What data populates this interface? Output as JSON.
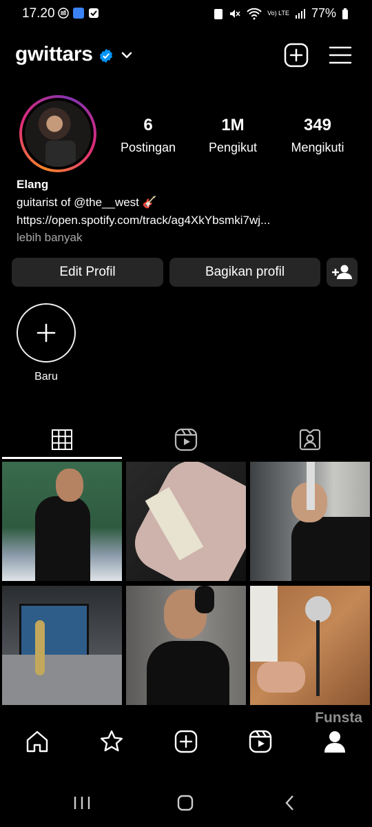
{
  "status_bar": {
    "time": "17.20",
    "battery": "77%",
    "network": "Vo) LTE"
  },
  "header": {
    "username": "gwittars",
    "icons": [
      "verified-badge-icon",
      "chevron-down-icon",
      "create-post-icon",
      "menu-icon"
    ],
    "accent_color": "#0095f6"
  },
  "profile": {
    "stats": [
      {
        "value": "6",
        "label": "Postingan"
      },
      {
        "value": "1M",
        "label": "Pengikut"
      },
      {
        "value": "349",
        "label": "Mengikuti"
      }
    ],
    "name": "Elang",
    "bio_line": "guitarist of @the__west 🎸",
    "link": "https://open.spotify.com/track/ag4XkYbsmki7wj...",
    "more_label": "lebih banyak"
  },
  "actions": {
    "edit_label": "Edit Profil",
    "share_label": "Bagikan profil",
    "discover_icon": "add-person-icon"
  },
  "highlights": {
    "new_label": "Baru"
  },
  "tabs": [
    "grid-icon",
    "reels-icon",
    "tagged-icon"
  ],
  "posts": [
    {
      "desc": "man in black tank top by water"
    },
    {
      "desc": "pink electric guitar with cable"
    },
    {
      "desc": "singer at studio microphone"
    },
    {
      "desc": "studio mixing desk with microphone"
    },
    {
      "desc": "man with headphones in studio"
    },
    {
      "desc": "hand peace sign near microphone"
    }
  ],
  "bottom_nav": {
    "watermark": "Funsta",
    "items": [
      "home-icon",
      "star-icon",
      "create-icon",
      "reels-icon",
      "profile-icon"
    ]
  }
}
